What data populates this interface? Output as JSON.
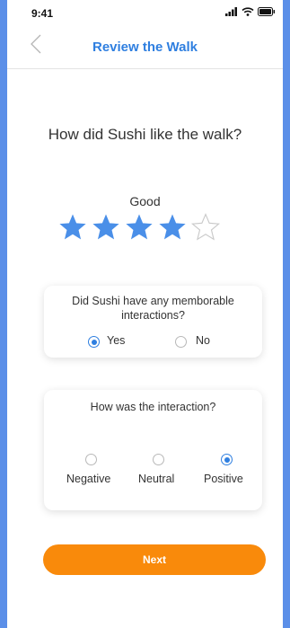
{
  "status_bar": {
    "time": "9:41",
    "icons": [
      "signal-icon",
      "wifi-icon",
      "battery-icon"
    ]
  },
  "nav": {
    "title": "Review the Walk",
    "back_icon": "chevron-left-icon"
  },
  "question": "How did Sushi like the walk?",
  "rating": {
    "label": "Good",
    "value": 4,
    "max": 5,
    "filled_color": "#4a8fe8",
    "empty_color": "#c9c9c9"
  },
  "interactions_card": {
    "question": "Did Sushi have any memborable interactions?",
    "options": [
      "Yes",
      "No"
    ],
    "selected": "Yes"
  },
  "sentiment_card": {
    "question": "How was the interaction?",
    "options": [
      "Negative",
      "Neutral",
      "Positive"
    ],
    "selected": "Positive"
  },
  "next_button": {
    "label": "Next",
    "color": "#f98a0b"
  },
  "accent_color": "#2f7fe0"
}
